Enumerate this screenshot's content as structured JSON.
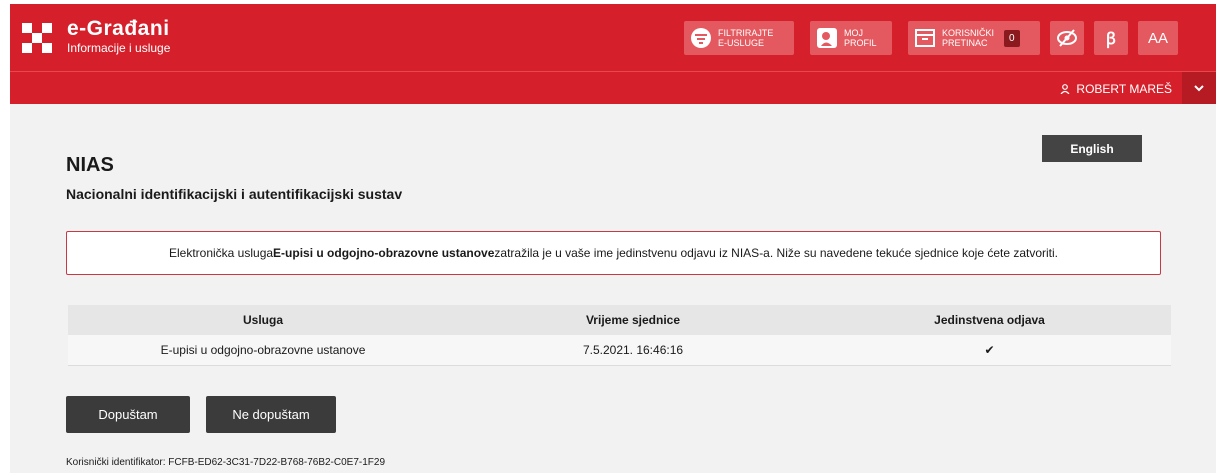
{
  "header": {
    "brand_title": "e-Građani",
    "brand_subtitle": "Informacije i usluge",
    "filter_label_1": "FILTRIRAJTE",
    "filter_label_2": "E-USLUGE",
    "profile_label_1": "MOJ",
    "profile_label_2": "PROFIL",
    "inbox_label_1": "KORISNIČKI",
    "inbox_label_2": "PRETINAC",
    "inbox_count": "0",
    "b_label": "ꞵ",
    "aa_label": "AA",
    "icons": {
      "filter": "filter-icon",
      "profile": "profile-icon",
      "inbox": "inbox-icon",
      "eye": "eye-slash-icon",
      "user": "user-icon",
      "chevron": "chevron-down-icon"
    }
  },
  "userbar": {
    "name": "ROBERT MAREŠ"
  },
  "language": "English",
  "page": {
    "title": "NIAS",
    "subtitle": "Nacionalni identifikacijski i autentifikacijski sustav"
  },
  "notice": {
    "prefix": "Elektronička usluga ",
    "service": "E-upisi u odgojno-obrazovne ustanove",
    "suffix": " zatražila je u vaše ime jedinstvenu odjavu iz NIAS-a. Niže su navedene tekuće sjednice koje ćete zatvoriti."
  },
  "table": {
    "headers": [
      "Usluga",
      "Vrijeme sjednice",
      "Jedinstvena odjava"
    ],
    "rows": [
      [
        "E-upisi u odgojno-obrazovne ustanove",
        "7.5.2021. 16:46:16",
        "✔"
      ]
    ]
  },
  "actions": {
    "accept": "Dopuštam",
    "decline": "Ne dopuštam"
  },
  "footer": {
    "identifier": "Korisnički identifikator: FCFB-ED62-3C31-7D22-B768-76B2-C0E7-1F29"
  },
  "colors": {
    "brand_red": "#d5202b",
    "button_dark": "#3b3b3b"
  }
}
